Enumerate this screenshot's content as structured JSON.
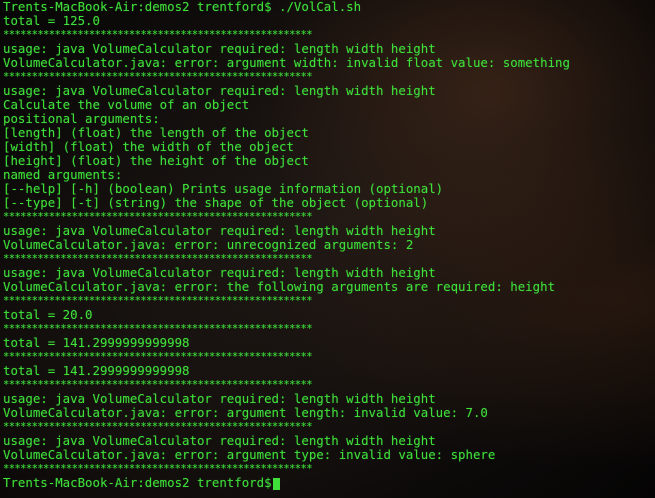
{
  "terminal": {
    "lines": [
      "Trents-MacBook-Air:demos2 trentford$ ./VolCal.sh",
      "total = 125.0",
      "******************************************************",
      "usage: java VolumeCalculator required: length width height",
      "VolumeCalculator.java: error: argument width: invalid float value: something",
      "******************************************************",
      "usage: java VolumeCalculator required: length width height",
      "Calculate the volume of an object",
      "positional arguments:",
      "[length] (float) the length of the object",
      "[width] (float) the width of the object",
      "[height] (float) the height of the object",
      "named arguments:",
      "[--help] [-h] (boolean) Prints usage information (optional)",
      "[--type] [-t] (string) the shape of the object (optional)",
      "******************************************************",
      "usage: java VolumeCalculator required: length width height",
      "VolumeCalculator.java: error: unrecognized arguments: 2",
      "******************************************************",
      "usage: java VolumeCalculator required: length width height",
      "VolumeCalculator.java: error: the following arguments are required: height",
      "******************************************************",
      "total = 20.0",
      "******************************************************",
      "total = 141.2999999999998",
      "******************************************************",
      "total = 141.2999999999998",
      "******************************************************",
      "usage: java VolumeCalculator required: length width height",
      "VolumeCalculator.java: error: argument length: invalid value: 7.0",
      "******************************************************",
      "usage: java VolumeCalculator required: length width height",
      "VolumeCalculator.java: error: argument type: invalid value: sphere",
      "******************************************************"
    ],
    "prompt": "Trents-MacBook-Air:demos2 trentford$",
    "text_color": "#3fe03a"
  }
}
